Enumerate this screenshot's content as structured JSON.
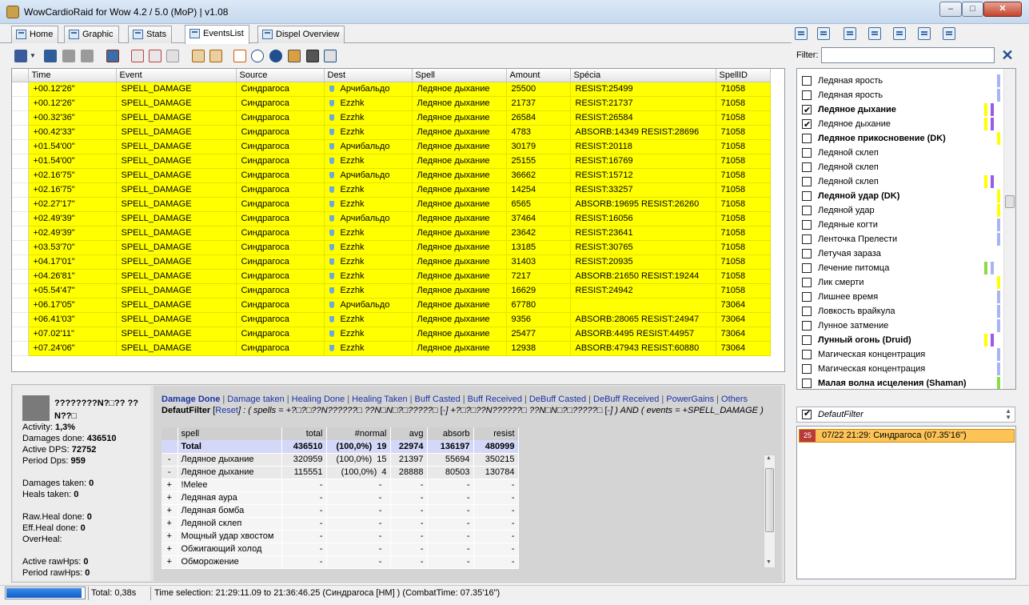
{
  "window": {
    "title": "WowCardioRaid for Wow 4.2 / 5.0 (MoP) | v1.08",
    "min": "–",
    "max": "□",
    "close": "✕"
  },
  "tabs": [
    {
      "label": "Home"
    },
    {
      "label": "Graphic"
    },
    {
      "label": "Stats"
    },
    {
      "label": "EventsList"
    },
    {
      "label": "Dispel Overview"
    }
  ],
  "grid": {
    "columns": [
      "Time",
      "Event",
      "Source",
      "Dest",
      "Spell",
      "Amount",
      "Spécia",
      "SpellID"
    ],
    "rows": [
      [
        "+00.12'26\"",
        "SPELL_DAMAGE",
        "Синдрагоса",
        "Арчибальдо",
        "Ледяное дыхание",
        "25500",
        "RESIST:25499",
        "71058"
      ],
      [
        "+00.12'26\"",
        "SPELL_DAMAGE",
        "Синдрагоса",
        "Ezzhk",
        "Ледяное дыхание",
        "21737",
        "RESIST:21737",
        "71058"
      ],
      [
        "+00.32'36\"",
        "SPELL_DAMAGE",
        "Синдрагоса",
        "Ezzhk",
        "Ледяное дыхание",
        "26584",
        "RESIST:26584",
        "71058"
      ],
      [
        "+00.42'33\"",
        "SPELL_DAMAGE",
        "Синдрагоса",
        "Ezzhk",
        "Ледяное дыхание",
        "4783",
        "ABSORB:14349 RESIST:28696",
        "71058"
      ],
      [
        "+01.54'00\"",
        "SPELL_DAMAGE",
        "Синдрагоса",
        "Арчибальдо",
        "Ледяное дыхание",
        "30179",
        "RESIST:20118",
        "71058"
      ],
      [
        "+01.54'00\"",
        "SPELL_DAMAGE",
        "Синдрагоса",
        "Ezzhk",
        "Ледяное дыхание",
        "25155",
        "RESIST:16769",
        "71058"
      ],
      [
        "+02.16'75\"",
        "SPELL_DAMAGE",
        "Синдрагоса",
        "Арчибальдо",
        "Ледяное дыхание",
        "36662",
        "RESIST:15712",
        "71058"
      ],
      [
        "+02.16'75\"",
        "SPELL_DAMAGE",
        "Синдрагоса",
        "Ezzhk",
        "Ледяное дыхание",
        "14254",
        "RESIST:33257",
        "71058"
      ],
      [
        "+02.27'17\"",
        "SPELL_DAMAGE",
        "Синдрагоса",
        "Ezzhk",
        "Ледяное дыхание",
        "6565",
        "ABSORB:19695 RESIST:26260",
        "71058"
      ],
      [
        "+02.49'39\"",
        "SPELL_DAMAGE",
        "Синдрагоса",
        "Арчибальдо",
        "Ледяное дыхание",
        "37464",
        "RESIST:16056",
        "71058"
      ],
      [
        "+02.49'39\"",
        "SPELL_DAMAGE",
        "Синдрагоса",
        "Ezzhk",
        "Ледяное дыхание",
        "23642",
        "RESIST:23641",
        "71058"
      ],
      [
        "+03.53'70\"",
        "SPELL_DAMAGE",
        "Синдрагоса",
        "Ezzhk",
        "Ледяное дыхание",
        "13185",
        "RESIST:30765",
        "71058"
      ],
      [
        "+04.17'01\"",
        "SPELL_DAMAGE",
        "Синдрагоса",
        "Ezzhk",
        "Ледяное дыхание",
        "31403",
        "RESIST:20935",
        "71058"
      ],
      [
        "+04.26'81\"",
        "SPELL_DAMAGE",
        "Синдрагоса",
        "Ezzhk",
        "Ледяное дыхание",
        "7217",
        "ABSORB:21650 RESIST:19244",
        "71058"
      ],
      [
        "+05.54'47\"",
        "SPELL_DAMAGE",
        "Синдрагоса",
        "Ezzhk",
        "Ледяное дыхание",
        "16629",
        "RESIST:24942",
        "71058"
      ],
      [
        "+06.17'05\"",
        "SPELL_DAMAGE",
        "Синдрагоса",
        "Арчибальдо",
        "Ледяное дыхание",
        "67780",
        "",
        "73064"
      ],
      [
        "+06.41'03\"",
        "SPELL_DAMAGE",
        "Синдрагоса",
        "Ezzhk",
        "Ледяное дыхание",
        "9356",
        "ABSORB:28065 RESIST:24947",
        "73064"
      ],
      [
        "+07.02'11\"",
        "SPELL_DAMAGE",
        "Синдрагоса",
        "Ezzhk",
        "Ледяное дыхание",
        "25477",
        "ABSORB:4495 RESIST:44957",
        "73064"
      ],
      [
        "+07.24'06\"",
        "SPELL_DAMAGE",
        "Синдрагоса",
        "Ezzhk",
        "Ледяное дыхание",
        "12938",
        "ABSORB:47943 RESIST:60880",
        "73064"
      ]
    ]
  },
  "player": {
    "name": "????????N?□?? ??N??□",
    "stats": [
      {
        "label": "Activity:",
        "value": "1,3%"
      },
      {
        "label": "Damages done:",
        "value": "436510"
      },
      {
        "label": "Active DPS:",
        "value": "72752"
      },
      {
        "label": "Period Dps:",
        "value": "959"
      },
      {
        "label": "Damages taken:",
        "value": "0"
      },
      {
        "label": "Heals taken:",
        "value": "0"
      },
      {
        "label": "Raw.Heal done:",
        "value": "0"
      },
      {
        "label": "Eff.Heal done:",
        "value": "0"
      },
      {
        "label": "OverHeal:",
        "value": ""
      },
      {
        "label": "Active rawHps:",
        "value": "0"
      },
      {
        "label": "Period rawHps:",
        "value": "0"
      }
    ]
  },
  "filters": {
    "links": [
      "Damage Done",
      "Damage taken",
      "Healing Done",
      "Healing Taken",
      "Buff Casted",
      "Buff Received",
      "DeBuff Casted",
      "DeBuff Received",
      "PowerGains",
      "Others"
    ],
    "default_label": "DefautFilter",
    "reset": "Reset",
    "expr_a": "] : ( spells = +?□?□??N??????□ ??N□N□?□?????□ ",
    "minus_link": "-",
    "expr_b": "] +?□?□??N??????□ ??N□N□?□?????□ ",
    "expr_c": "] ) AND ( events = +SPELL_DAMAGE )"
  },
  "spelltable": {
    "columns": [
      "spell",
      "total",
      "#normal",
      "avg",
      "absorb",
      "resist"
    ],
    "total": {
      "name": "Total",
      "total": "436510",
      "pct": "(100,0%)",
      "normal": "19",
      "avg": "22974",
      "absorb": "136197",
      "resist": "480999"
    },
    "rows": [
      {
        "pm": "-",
        "name": "Ледяное дыхание",
        "total": "320959",
        "pct": "(100,0%)",
        "normal": "15",
        "avg": "21397",
        "absorb": "55694",
        "resist": "350215"
      },
      {
        "pm": "-",
        "name": "Ледяное дыхание",
        "total": "115551",
        "pct": "(100,0%)",
        "normal": "4",
        "avg": "28888",
        "absorb": "80503",
        "resist": "130784"
      },
      {
        "pm": "+",
        "name": "!Melee",
        "total": "-",
        "pct": "-",
        "normal": "",
        "avg": "-",
        "absorb": "-",
        "resist": "-"
      },
      {
        "pm": "+",
        "name": "Ледяная аура",
        "total": "-",
        "pct": "-",
        "normal": "",
        "avg": "-",
        "absorb": "-",
        "resist": "-"
      },
      {
        "pm": "+",
        "name": "Ледяная бомба",
        "total": "-",
        "pct": "-",
        "normal": "",
        "avg": "-",
        "absorb": "-",
        "resist": "-"
      },
      {
        "pm": "+",
        "name": "Ледяной склеп",
        "total": "-",
        "pct": "-",
        "normal": "",
        "avg": "-",
        "absorb": "-",
        "resist": "-"
      },
      {
        "pm": "+",
        "name": "Мощный удар хвостом",
        "total": "-",
        "pct": "-",
        "normal": "",
        "avg": "-",
        "absorb": "-",
        "resist": "-"
      },
      {
        "pm": "+",
        "name": "Обжигающий холод",
        "total": "-",
        "pct": "-",
        "normal": "",
        "avg": "-",
        "absorb": "-",
        "resist": "-"
      },
      {
        "pm": "+",
        "name": "Обморожение",
        "total": "-",
        "pct": "-",
        "normal": "",
        "avg": "-",
        "absorb": "-",
        "resist": "-"
      }
    ]
  },
  "right": {
    "filter_label": "Filter:",
    "filter_value": "",
    "clear": "✕",
    "spells": [
      {
        "label": "Ледяная ярость",
        "checked": false,
        "bold": false,
        "bars": [
          "#aab4ee"
        ]
      },
      {
        "label": "Ледяная ярость",
        "checked": false,
        "bold": false,
        "bars": [
          "#aab4ee"
        ]
      },
      {
        "label": "Ледяное дыхание",
        "checked": true,
        "bold": true,
        "bars": [
          "#ffff00",
          "#9b59e6"
        ]
      },
      {
        "label": "Ледяное дыхание",
        "checked": true,
        "bold": false,
        "bars": [
          "#ffff00",
          "#9b59e6"
        ]
      },
      {
        "label": "Ледяное прикосновение (DK)",
        "checked": false,
        "bold": true,
        "bars": [
          "#ffff00"
        ]
      },
      {
        "label": "Ледяной склеп",
        "checked": false,
        "bold": false,
        "bars": []
      },
      {
        "label": "Ледяной склеп",
        "checked": false,
        "bold": false,
        "bars": []
      },
      {
        "label": "Ледяной склеп",
        "checked": false,
        "bold": false,
        "bars": [
          "#ffff00",
          "#9b59e6"
        ]
      },
      {
        "label": "Ледяной удар (DK)",
        "checked": false,
        "bold": true,
        "bars": [
          "#ffff00"
        ]
      },
      {
        "label": "Ледяной удар",
        "checked": false,
        "bold": false,
        "bars": [
          "#ffff00"
        ]
      },
      {
        "label": "Ледяные когти",
        "checked": false,
        "bold": false,
        "bars": [
          "#aab4ee"
        ]
      },
      {
        "label": "Ленточка Прелести",
        "checked": false,
        "bold": false,
        "bars": [
          "#aab4ee"
        ]
      },
      {
        "label": "Летучая зараза",
        "checked": false,
        "bold": false,
        "bars": []
      },
      {
        "label": "Лечение питомца",
        "checked": false,
        "bold": false,
        "bars": [
          "#88dd44",
          "#aab4ee"
        ]
      },
      {
        "label": "Лик смерти",
        "checked": false,
        "bold": false,
        "bars": [
          "#ffff00"
        ]
      },
      {
        "label": "Лишнее время",
        "checked": false,
        "bold": false,
        "bars": [
          "#aab4ee"
        ]
      },
      {
        "label": "Ловкость врайкула",
        "checked": false,
        "bold": false,
        "bars": [
          "#aab4ee"
        ]
      },
      {
        "label": "Лунное затмение",
        "checked": false,
        "bold": false,
        "bars": [
          "#aab4ee"
        ]
      },
      {
        "label": "Лунный огонь (Druid)",
        "checked": false,
        "bold": true,
        "bars": [
          "#ffff00",
          "#9b59e6"
        ]
      },
      {
        "label": "Магическая концентрация",
        "checked": false,
        "bold": false,
        "bars": [
          "#aab4ee"
        ]
      },
      {
        "label": "Магическая концентрация",
        "checked": false,
        "bold": false,
        "bars": [
          "#aab4ee"
        ]
      },
      {
        "label": "Малая волна исцеления (Shaman)",
        "checked": false,
        "bold": true,
        "bars": [
          "#88dd44"
        ]
      }
    ],
    "default_filter": "DefautFilter",
    "session": {
      "num": "25",
      "text": "07/22  21:29: Синдрагоса (07.35'16\")"
    }
  },
  "status": {
    "progress": 0.97,
    "total": "Total: 0,38s",
    "selection": "Time selection: 21:29:11.09 to 21:36:46.25 (Синдрагоса [HM] )  (CombatTime: 07.35'16\")"
  }
}
